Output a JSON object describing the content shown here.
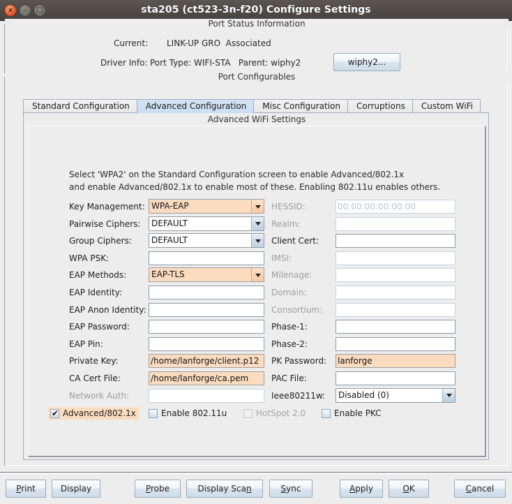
{
  "window": {
    "title": "sta205  (ct523-3n-f20) Configure Settings",
    "buttons": {
      "close": "x",
      "minimize": "–",
      "maximize": "□"
    }
  },
  "status_panel": {
    "title": "Port Status Information",
    "current_label": "Current:",
    "current_value": "LINK-UP GRO  Associated",
    "driver_label": "Driver Info:",
    "driver_value": "Port Type: WIFI-STA   Parent: wiphy2",
    "wiphy_button": "wiphy2..."
  },
  "config_panel": {
    "title": "Port Configurables",
    "tabs": [
      {
        "label": "Standard Configuration",
        "selected": false
      },
      {
        "label": "Advanced Configuration",
        "selected": true
      },
      {
        "label": "Misc Configuration",
        "selected": false
      },
      {
        "label": "Corruptions",
        "selected": false
      },
      {
        "label": "Custom WiFi",
        "selected": false
      }
    ],
    "panel_title": "Advanced WiFi Settings",
    "hint_line1": "Select 'WPA2' on the Standard Configuration screen to enable Advanced/802.1x",
    "hint_line2": "and enable Advanced/802.1x to enable most of these. Enabling 802.11u enables others."
  },
  "left_fields": [
    {
      "label": "Key Management:",
      "type": "combo",
      "value": "WPA-EAP",
      "highlight": true,
      "disabled": false
    },
    {
      "label": "Pairwise Ciphers:",
      "type": "combo",
      "value": "DEFAULT",
      "highlight": false,
      "disabled": false
    },
    {
      "label": "Group Ciphers:",
      "type": "combo",
      "value": "DEFAULT",
      "highlight": false,
      "disabled": false
    },
    {
      "label": "WPA PSK:",
      "type": "text",
      "value": "",
      "highlight": false,
      "disabled": false
    },
    {
      "label": "EAP Methods:",
      "type": "combo",
      "value": "EAP-TLS",
      "highlight": true,
      "disabled": false
    },
    {
      "label": "EAP Identity:",
      "type": "text",
      "value": "",
      "highlight": false,
      "disabled": false
    },
    {
      "label": "EAP Anon Identity:",
      "type": "text",
      "value": "",
      "highlight": false,
      "disabled": false
    },
    {
      "label": "EAP Password:",
      "type": "text",
      "value": "",
      "highlight": false,
      "disabled": false
    },
    {
      "label": "EAP Pin:",
      "type": "text",
      "value": "",
      "highlight": false,
      "disabled": false
    },
    {
      "label": "Private Key:",
      "type": "text",
      "value": "/home/lanforge/client.p12",
      "highlight": true,
      "disabled": false
    },
    {
      "label": "CA Cert File:",
      "type": "text",
      "value": "/home/lanforge/ca.pem",
      "highlight": true,
      "disabled": false
    },
    {
      "label": "Network Auth:",
      "type": "text",
      "value": "",
      "highlight": false,
      "disabled": true
    }
  ],
  "right_fields": [
    {
      "label": "HESSID:",
      "type": "text",
      "value": "00:00:00:00:00:00",
      "highlight": false,
      "disabled": true
    },
    {
      "label": "Realm:",
      "type": "text",
      "value": "",
      "highlight": false,
      "disabled": true
    },
    {
      "label": "Client Cert:",
      "type": "text",
      "value": "",
      "highlight": false,
      "disabled": false
    },
    {
      "label": "IMSI:",
      "type": "text",
      "value": "",
      "highlight": false,
      "disabled": true
    },
    {
      "label": "Milenage:",
      "type": "text",
      "value": "",
      "highlight": false,
      "disabled": true
    },
    {
      "label": "Domain:",
      "type": "text",
      "value": "",
      "highlight": false,
      "disabled": true
    },
    {
      "label": "Consortium:",
      "type": "text",
      "value": "",
      "highlight": false,
      "disabled": true
    },
    {
      "label": "Phase-1:",
      "type": "text",
      "value": "",
      "highlight": false,
      "disabled": false
    },
    {
      "label": "Phase-2:",
      "type": "text",
      "value": "",
      "highlight": false,
      "disabled": false
    },
    {
      "label": "PK Password:",
      "type": "text",
      "value": "lanforge",
      "highlight": true,
      "disabled": false
    },
    {
      "label": "PAC File:",
      "type": "text",
      "value": "",
      "highlight": false,
      "disabled": false
    },
    {
      "label": "Ieee80211w:",
      "type": "combo",
      "value": "Disabled (0)",
      "highlight": false,
      "disabled": false
    }
  ],
  "checkboxes": [
    {
      "label": "Advanced/802.1x",
      "checked": true,
      "disabled": false,
      "highlight": true
    },
    {
      "label": "Enable 802.11u",
      "checked": false,
      "disabled": false,
      "highlight": false
    },
    {
      "label": "HotSpot 2.0",
      "checked": false,
      "disabled": true,
      "highlight": false
    },
    {
      "label": "Enable PKC",
      "checked": false,
      "disabled": false,
      "highlight": false
    }
  ],
  "bottom_buttons": [
    {
      "label": "Print",
      "mnemonic_index": 0
    },
    {
      "label": "Display",
      "mnemonic_index": -1
    },
    {
      "label": "Probe",
      "mnemonic_index": 0
    },
    {
      "label": "Display Scan",
      "mnemonic_index": 11
    },
    {
      "label": "Sync",
      "mnemonic_index": 0
    },
    {
      "label": "Apply",
      "mnemonic_index": 0
    },
    {
      "label": "OK",
      "mnemonic_index": 0
    },
    {
      "label": "Cancel",
      "mnemonic_index": 0
    }
  ],
  "colors": {
    "highlight": "#fbdcc0",
    "titlebar": "#504b47",
    "panel": "#ededed",
    "tab_selected": "#cfe0f4",
    "field_border": "#8d9aa8",
    "disabled_text": "#9d9d9d"
  }
}
